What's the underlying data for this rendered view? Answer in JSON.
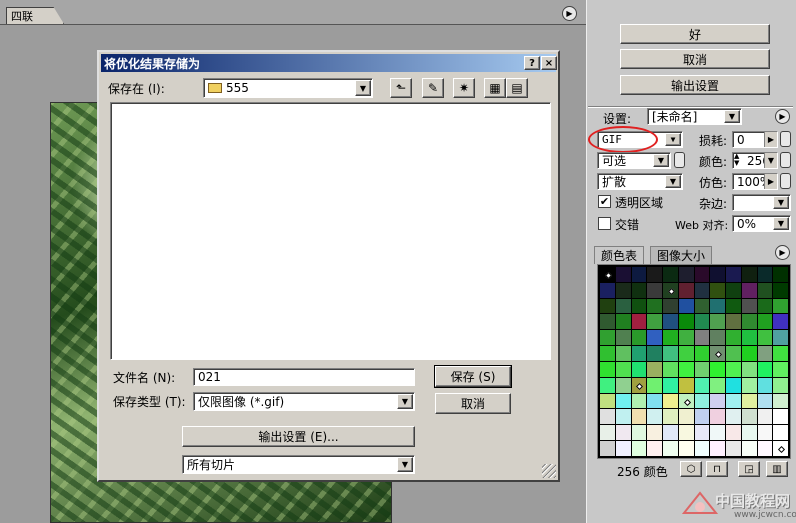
{
  "doc_tab": {
    "label": "四联"
  },
  "dialog": {
    "title": "将优化结果存储为",
    "title_buttons": {
      "help": "?",
      "close": "×"
    },
    "save_in_label": "保存在 (I):",
    "save_in_value": "555",
    "filename_label": "文件名 (N):",
    "filename_value": "021",
    "filetype_label": "保存类型 (T):",
    "filetype_value": "仅限图像 (*.gif)",
    "save_button": "保存 (S)",
    "cancel_button": "取消",
    "output_settings_button": "输出设置 (E)...",
    "slices_value": "所有切片"
  },
  "right_panel": {
    "buttons": {
      "ok": "好",
      "cancel": "取消",
      "output_settings": "输出设置"
    },
    "settings_label": "设置:",
    "settings_value": "[未命名]",
    "format_value": "GIF",
    "lossy_label": "损耗:",
    "lossy_value": "0",
    "palette_value": "可选",
    "colors_label": "颜色:",
    "colors_value": "256",
    "dither_method_value": "扩散",
    "dither_label": "仿色:",
    "dither_value": "100%",
    "transparency_label": "透明区域",
    "transparency_checked": true,
    "matte_label": "杂边:",
    "matte_value": "",
    "interlaced_label": "交错",
    "interlaced_checked": false,
    "web_snap_label": "Web 对齐:",
    "web_snap_value": "0%",
    "tabs": [
      "颜色表",
      "图像大小"
    ],
    "color_count_label": "256 颜色",
    "highlight_color": "#e02020"
  },
  "watermark": {
    "site": "中国教程网",
    "url": "www.jcwcn.com"
  },
  "colors": {
    "accent_titlebar": "#0a246a",
    "panel_bg": "#c8c8c8",
    "dialog_bg": "#d4d0c8"
  },
  "swatches": [
    "#000000",
    "#1a0f33",
    "#0d1a40",
    "#1a1a1a",
    "#0b2a12",
    "#1e1e2e",
    "#2a0a2a",
    "#101030",
    "#1a1a50",
    "#102010",
    "#0a2a2a",
    "#003000",
    "#1a2060",
    "#1a2a1a",
    "#103010",
    "#3a3a3a",
    "#204020",
    "#602030",
    "#203040",
    "#305010",
    "#104010",
    "#602060",
    "#205020",
    "#003a00",
    "#204010",
    "#2a6040",
    "#105010",
    "#207020",
    "#304030",
    "#2050a0",
    "#306030",
    "#207070",
    "#105a10",
    "#505050",
    "#1a6a1a",
    "#30a030",
    "#305a30",
    "#208020",
    "#a02040",
    "#40a040",
    "#205080",
    "#0a8a0a",
    "#208a50",
    "#50a050",
    "#607040",
    "#308a30",
    "#20a020",
    "#4030c0",
    "#30a030",
    "#508050",
    "#2a9a2a",
    "#3060c0",
    "#20b020",
    "#40b040",
    "#808080",
    "#608060",
    "#30b030",
    "#20c040",
    "#40c040",
    "#50a0a0",
    "#30c030",
    "#60c060",
    "#20a070",
    "#208060",
    "#40c080",
    "#40d040",
    "#30d030",
    "#709070",
    "#50c050",
    "#20d020",
    "#80a080",
    "#40e040",
    "#30e030",
    "#50e050",
    "#20e070",
    "#9ab060",
    "#60e060",
    "#40f040",
    "#70d070",
    "#30f030",
    "#50f050",
    "#80e080",
    "#20f060",
    "#60f060",
    "#40f080",
    "#90d090",
    "#a0a040",
    "#70f070",
    "#30f0a0",
    "#c0c040",
    "#50f0b0",
    "#80f080",
    "#20e0e0",
    "#a0f0a0",
    "#60e0e0",
    "#90f090",
    "#c0e080",
    "#70f0f0",
    "#b0f0b0",
    "#80e0f0",
    "#f0f090",
    "#c0f0c0",
    "#90f0e0",
    "#d0d0f0",
    "#a0f0f0",
    "#e0f0a0",
    "#b0e0f0",
    "#d0f0d0",
    "#e0e0e0",
    "#c0f0f0",
    "#f0e0b0",
    "#d0f0f0",
    "#e0f0c0",
    "#f0f0d0",
    "#c0d0f0",
    "#f0d0e0",
    "#e0f0f0",
    "#d0e0d0",
    "#f0f0f0",
    "#ffffff",
    "#e8f0e8",
    "#f0e8f0",
    "#e0f8e0",
    "#f8f0e0",
    "#e0e8f8",
    "#f8f8e0",
    "#e8e8f8",
    "#f0f8f8",
    "#f8e8e8",
    "#e8f8f0",
    "#f8f8f8",
    "#ffffff",
    "#d0d0d0",
    "#f0f0ff",
    "#e0ffe0",
    "#fff0f0",
    "#f0fff0",
    "#fffff0",
    "#f0ffff",
    "#fff0ff",
    "#e8e8e8",
    "#f8fff8",
    "#fff8ff",
    "#ffffff"
  ],
  "swatch_dots": [
    0,
    16,
    67,
    86,
    101,
    143
  ]
}
